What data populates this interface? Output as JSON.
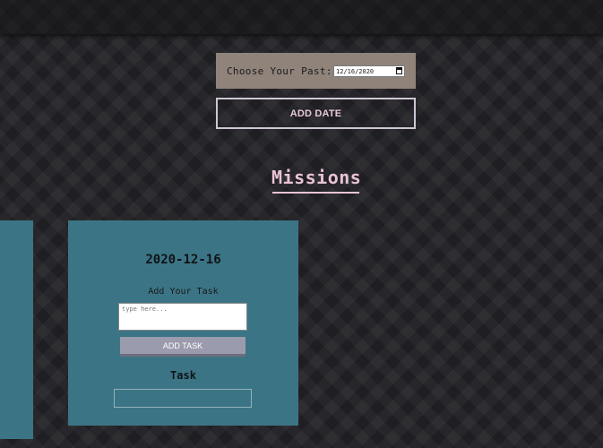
{
  "date_picker": {
    "label": "Choose Your Past:",
    "value": "12/16/2020"
  },
  "add_date_button": "ADD DATE",
  "missions_heading": "Missions",
  "card": {
    "date": "2020-12-16",
    "add_task_label": "Add Your Task",
    "task_placeholder": "type here...",
    "add_task_button": "ADD TASK",
    "task_heading": "Task"
  },
  "icons": [
    "calendar-icon"
  ]
}
